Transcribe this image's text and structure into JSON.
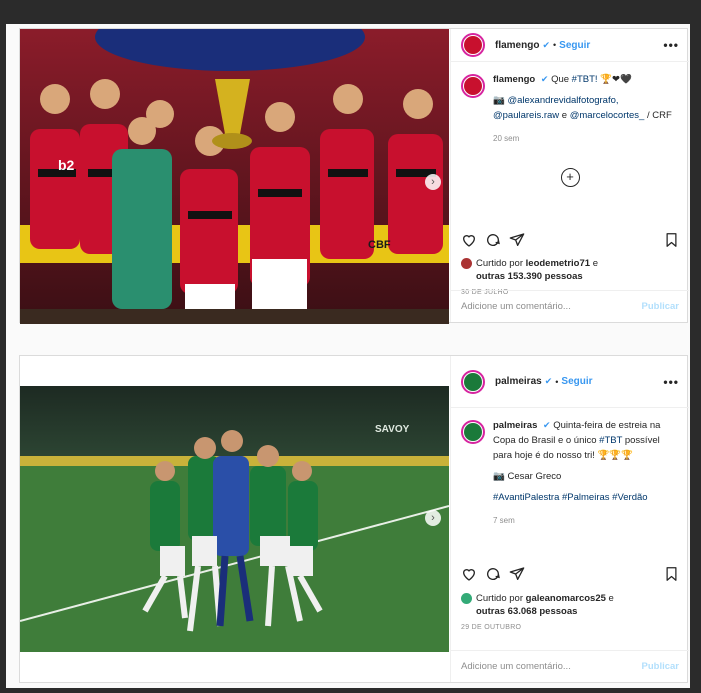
{
  "posts": [
    {
      "username": "flamengo",
      "verified_mark": "✔",
      "dot": "•",
      "follow_label": "Seguir",
      "more": "•••",
      "caption_user": "flamengo",
      "caption_text": "Que",
      "caption_hashtag": "#TBT!",
      "caption_emojis": "🏆❤🖤",
      "credit_icon": "📷",
      "credit_links": [
        "@alexandrevidalfotografo,",
        "@paulareis.raw",
        "@marcelocortes_"
      ],
      "credit_and": "e",
      "credit_tail": "/ CRF",
      "time": "20 sem",
      "liked_by_prefix": "Curtido por",
      "liked_by_user": "leodemetrio71",
      "liked_by_and": "e",
      "liked_by_others": "outras 153.390 pessoas",
      "date": "30 DE JULHO",
      "comment_placeholder": "Adicione um comentário...",
      "publish_label": "Publicar",
      "photo_labels": {
        "sponsor": "b2",
        "banner": "CBF"
      },
      "colors": {
        "jersey_red": "#c8102e",
        "jersey_black": "#111111",
        "banner": "#e8c515",
        "gk": "#2a8f6f"
      }
    },
    {
      "username": "palmeiras",
      "verified_mark": "✔",
      "dot": "•",
      "follow_label": "Seguir",
      "more": "•••",
      "caption_user": "palmeiras",
      "caption_text": "Quinta-feira de estreia na Copa do Brasil e o único",
      "caption_hashtag": "#TBT",
      "caption_text2": "possível para hoje é do nosso tri!",
      "caption_emojis": "🏆🏆🏆",
      "credit_icon": "📷",
      "credit_name": "Cesar Greco",
      "hashtags": "#AvantiPalestra #Palmeiras #Verdão",
      "time": "7 sem",
      "liked_by_prefix": "Curtido por",
      "liked_by_user": "galeanomarcos25",
      "liked_by_and": "e",
      "liked_by_others": "outras 63.068 pessoas",
      "date": "29 DE OUTUBRO",
      "comment_placeholder": "Adicione um comentário...",
      "publish_label": "Publicar",
      "photo_labels": {
        "stand": "SAVOY"
      },
      "colors": {
        "pitch": "#3f7d3a",
        "jersey_green": "#1b7a3a",
        "gk": "#2a4fa8"
      }
    }
  ],
  "icons": [
    "heart-icon",
    "comment-icon",
    "share-icon",
    "bookmark-icon",
    "plus-icon",
    "chevron-right-icon"
  ]
}
